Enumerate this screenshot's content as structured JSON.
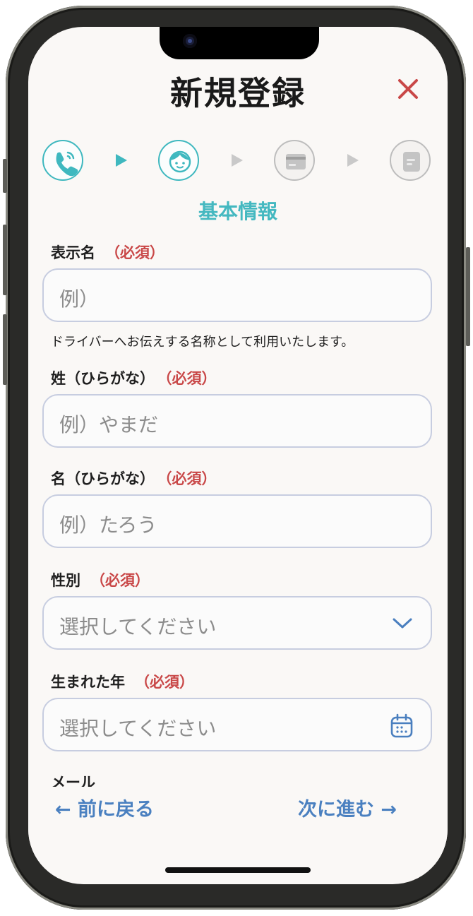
{
  "header": {
    "title": "新規登録",
    "close_icon": "close-icon"
  },
  "steps": [
    {
      "icon": "phone-icon",
      "state": "completed"
    },
    {
      "icon": "face-icon",
      "state": "current"
    },
    {
      "icon": "card-icon",
      "state": "upcoming"
    },
    {
      "icon": "document-icon",
      "state": "upcoming"
    }
  ],
  "section_title": "基本情報",
  "form": {
    "display_name": {
      "label": "表示名",
      "required": "（必須）",
      "placeholder": "例）",
      "hint": "ドライバーへお伝えする名称として利用いたします。"
    },
    "last_name_kana": {
      "label": "姓（ひらがな）",
      "required": "（必須）",
      "placeholder": "例）やまだ"
    },
    "first_name_kana": {
      "label": "名（ひらがな）",
      "required": "（必須）",
      "placeholder": "例）たろう"
    },
    "gender": {
      "label": "性別",
      "required": "（必須）",
      "placeholder": "選択してください",
      "icon": "chevron-down-icon"
    },
    "birth_year": {
      "label": "生まれた年",
      "required": "（必須）",
      "placeholder": "選択してください",
      "icon": "calendar-icon"
    },
    "email": {
      "label": "メール"
    }
  },
  "nav": {
    "prev_label": "← 前に戻る",
    "next_label": "次に進む →"
  },
  "colors": {
    "accent": "#3fb8bf",
    "required": "#c94848",
    "nav_link": "#4a80c0",
    "close": "#c94848"
  }
}
